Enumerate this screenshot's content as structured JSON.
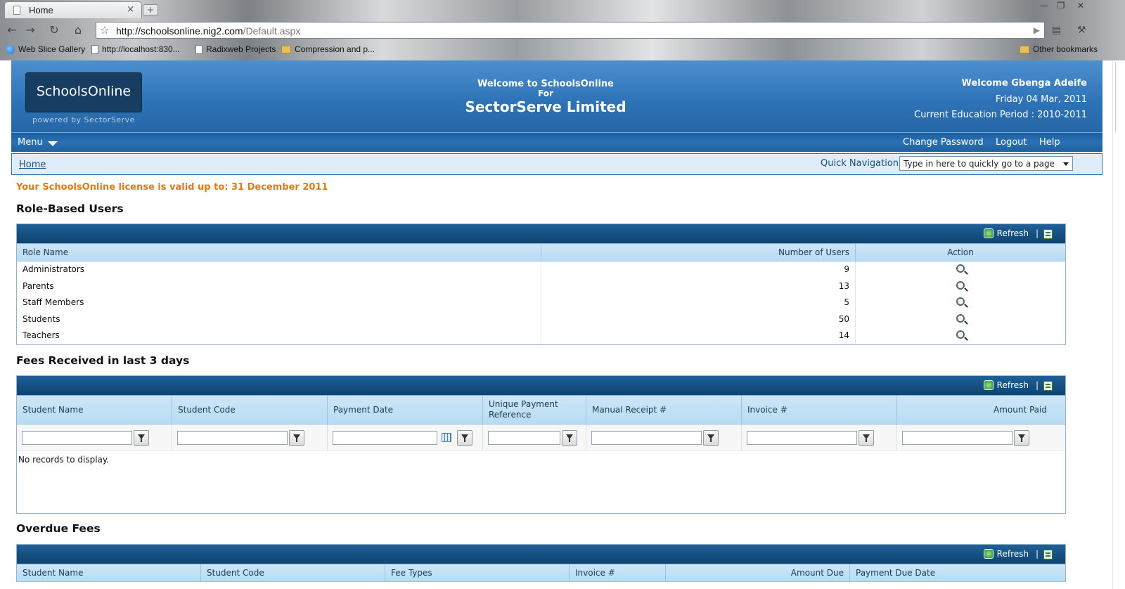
{
  "browser": {
    "tab_title": "Home",
    "tab_close": "×",
    "new_tab": "+",
    "url_host": "http://schoolsonline.nig2.com",
    "url_path": "/Default.aspx",
    "bookmarks": [
      {
        "label": "Web Slice Gallery",
        "icon": "globe-icon"
      },
      {
        "label": "http://localhost:830...",
        "icon": "page-icon"
      },
      {
        "label": "Radixweb Projects",
        "icon": "page-icon"
      },
      {
        "label": "Compression and p...",
        "icon": "folder-icon"
      }
    ],
    "other_bookmarks": "Other bookmarks"
  },
  "header": {
    "logo_text": "SchoolsOnline",
    "powered_by": "powered by SectorServe",
    "welcome_line1": "Welcome to SchoolsOnline",
    "welcome_line2": "For",
    "org_name": "SectorServe Limited",
    "user_greeting": "Welcome Gbenga Adeife",
    "date": "Friday 04 Mar, 2011",
    "education_period": "Current Education Period : 2010-2011"
  },
  "menubar": {
    "menu_label": "Menu",
    "change_password": "Change Password",
    "logout": "Logout",
    "help": "Help"
  },
  "breadcrumb": {
    "home": "Home",
    "quick_nav_label": "Quick Navigation:",
    "quick_nav_value": "Type in here to quickly go to a page"
  },
  "license_notice": "Your SchoolsOnline license is valid up to: 31 December 2011",
  "refresh_label": "Refresh",
  "cmd_separator": "|",
  "role_users": {
    "title": "Role-Based Users",
    "columns": [
      "Role Name",
      "Number of Users",
      "Action"
    ],
    "rows": [
      {
        "role": "Administrators",
        "count": "9"
      },
      {
        "role": "Parents",
        "count": "13"
      },
      {
        "role": "Staff Members",
        "count": "5"
      },
      {
        "role": "Students",
        "count": "50"
      },
      {
        "role": "Teachers",
        "count": "14"
      }
    ]
  },
  "fees_received": {
    "title": "Fees Received in last 3 days",
    "columns": [
      "Student Name",
      "Student Code",
      "Payment Date",
      "Unique Payment Reference",
      "Manual Receipt #",
      "Invoice #",
      "Amount Paid"
    ],
    "no_records": "No records to display."
  },
  "overdue_fees": {
    "title": "Overdue Fees",
    "columns": [
      "Student Name",
      "Student Code",
      "Fee Types",
      "Invoice #",
      "Amount Due",
      "Payment Due Date"
    ]
  },
  "colors": {
    "header_blue": "#2f74b8",
    "license_orange": "#e07b17",
    "grid_command": "#134e80",
    "grid_header": "#b8dcf3"
  }
}
